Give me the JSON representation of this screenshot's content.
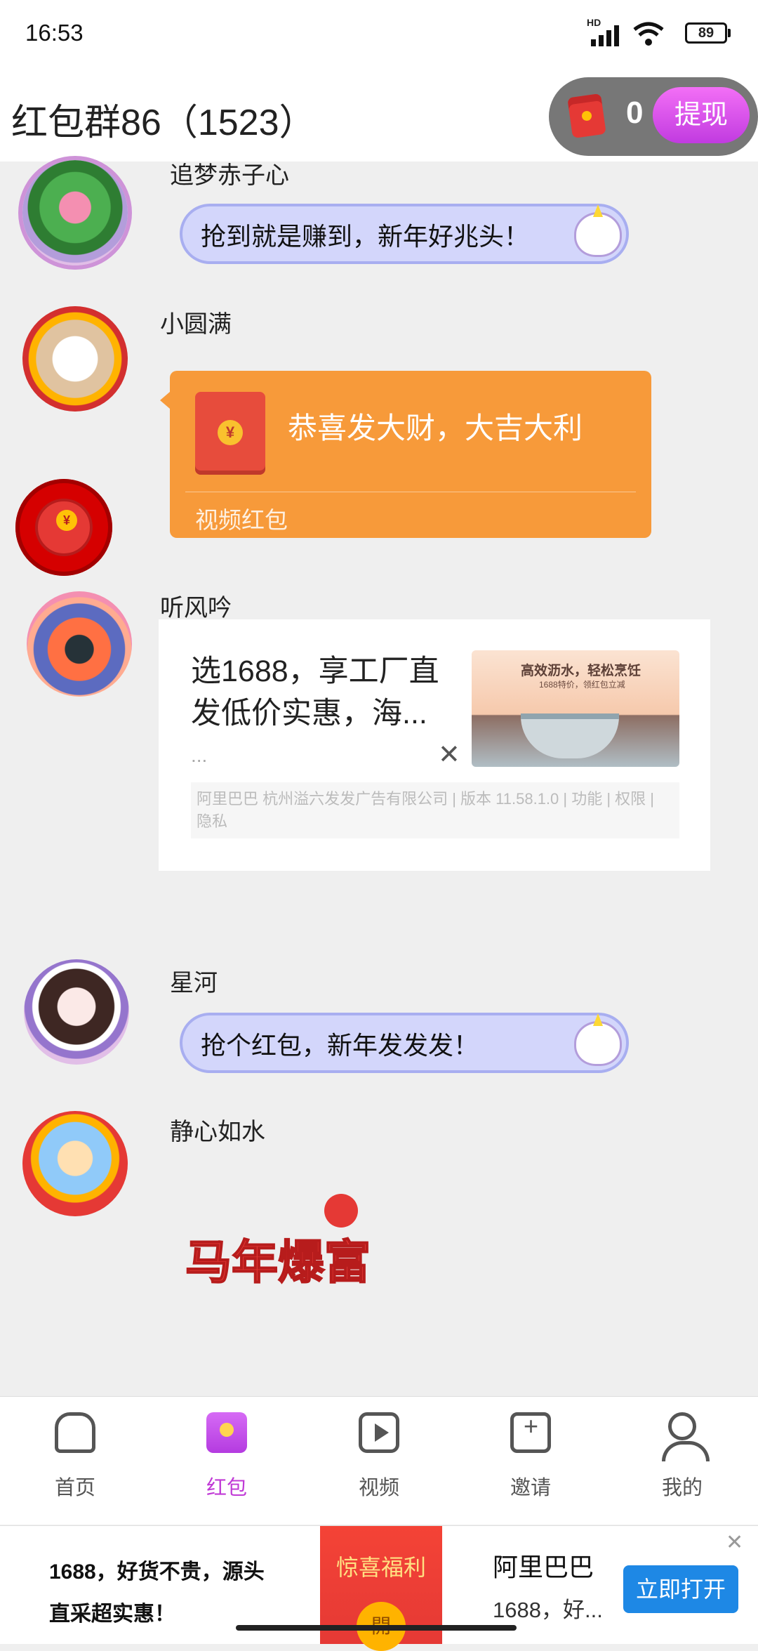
{
  "status_bar": {
    "time": "16:53",
    "battery": "89",
    "signal_badge": "HD"
  },
  "header": {
    "title": "红包群86（1523）",
    "balance": "0",
    "withdraw_label": "提现"
  },
  "messages": [
    {
      "user": "追梦赤子心",
      "text": "抢到就是赚到，新年好兆头！"
    },
    {
      "user": "小圆满",
      "packet_title": "恭喜发大财，大吉大利",
      "packet_label": "视频红包"
    },
    {
      "user": "听风吟",
      "ad_text": "选1688，享工厂直发低价实惠，海...",
      "ad_dots": "...",
      "ad_image_caption": "高效沥水，轻松烹饪",
      "ad_image_sub": "1688特价，领红包立减",
      "ad_footer": "阿里巴巴 杭州溢六发发广告有限公司 | 版本 11.58.1.0 | 功能 | 权限 | 隐私"
    },
    {
      "user": "星河",
      "text": "抢个红包，新年发发发！"
    },
    {
      "user": "静心如水",
      "sticker": "马年爆富"
    }
  ],
  "coin_symbol": "¥",
  "close_symbol": "✕",
  "tabs": [
    {
      "label": "首页",
      "icon": "home-icon"
    },
    {
      "label": "红包",
      "icon": "red-packet-icon",
      "active": true
    },
    {
      "label": "视频",
      "icon": "video-icon"
    },
    {
      "label": "邀请",
      "icon": "invite-icon"
    },
    {
      "label": "我的",
      "icon": "profile-icon"
    }
  ],
  "bottom_ad": {
    "text_line1": "1688，好货不贵，源头",
    "text_line2": "直采超实惠！",
    "banner_label": "惊喜福利",
    "seal": "開",
    "brand": "阿里巴巴",
    "desc": "1688，好...",
    "button": "立即打开"
  },
  "colors": {
    "accent_purple": "#c03ad6",
    "packet_orange": "#f79a3a",
    "bubble_lilac": "#d3d6fb",
    "ad_button_blue": "#1e88e5"
  }
}
